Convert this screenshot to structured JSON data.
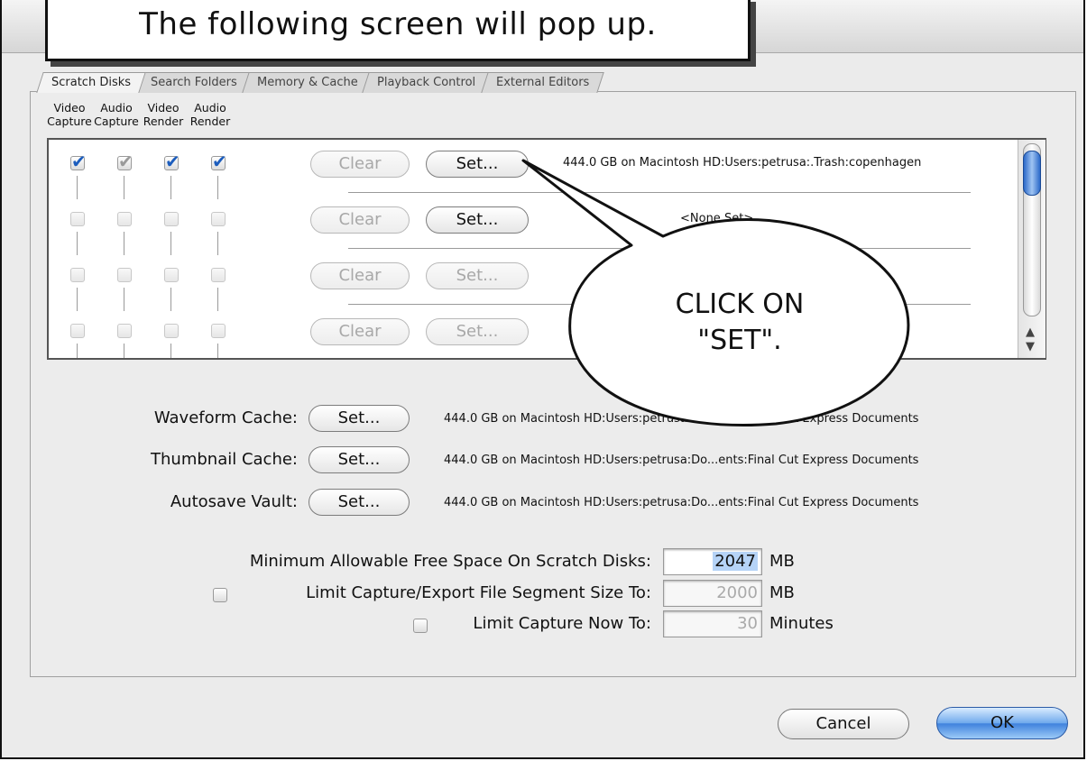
{
  "caption": "The following screen will pop up.",
  "tabs": [
    "Scratch Disks",
    "Search Folders",
    "Memory & Cache",
    "Playback Control",
    "External Editors"
  ],
  "columns": [
    {
      "line1": "Video",
      "line2": "Capture"
    },
    {
      "line1": "Audio",
      "line2": "Capture"
    },
    {
      "line1": "Video",
      "line2": "Render"
    },
    {
      "line1": "Audio",
      "line2": "Render"
    }
  ],
  "rows": [
    {
      "checks": [
        true,
        true,
        true,
        true
      ],
      "clear_label": "Clear",
      "set_label": "Set...",
      "path": "444.0 GB on  Macintosh HD:Users:petrusa:.Trash:copenhagen"
    },
    {
      "checks": [
        false,
        false,
        false,
        false
      ],
      "clear_label": "Clear",
      "set_label": "Set...",
      "path": "<None Set>"
    },
    {
      "checks": [
        false,
        false,
        false,
        false
      ],
      "clear_label": "Clear",
      "set_label": "Set...",
      "path": ""
    },
    {
      "checks": [
        false,
        false,
        false,
        false
      ],
      "clear_label": "Clear",
      "set_label": "Set...",
      "path": ""
    }
  ],
  "cache": [
    {
      "label": "Waveform Cache:",
      "set_label": "Set...",
      "path": "444.0 GB on  Macintosh HD:Users:petrusa:Do...ents:Final Cut Express Documents"
    },
    {
      "label": "Thumbnail Cache:",
      "set_label": "Set...",
      "path": "444.0 GB on  Macintosh HD:Users:petrusa:Do...ents:Final Cut Express Documents"
    },
    {
      "label": "Autosave Vault:",
      "set_label": "Set...",
      "path": "444.0 GB on  Macintosh HD:Users:petrusa:Do...ents:Final Cut Express Documents"
    }
  ],
  "min_free": {
    "label": "Minimum Allowable Free Space On Scratch Disks:",
    "value": "2047",
    "unit": "MB"
  },
  "limit_segment": {
    "label": "Limit Capture/Export File Segment Size To:",
    "value": "2000",
    "unit": "MB"
  },
  "limit_capture": {
    "label": "Limit Capture Now To:",
    "value": "30",
    "unit": "Minutes"
  },
  "buttons": {
    "cancel": "Cancel",
    "ok": "OK"
  },
  "callout": {
    "line1": "CLICK ON",
    "line2": "\"SET\"."
  }
}
